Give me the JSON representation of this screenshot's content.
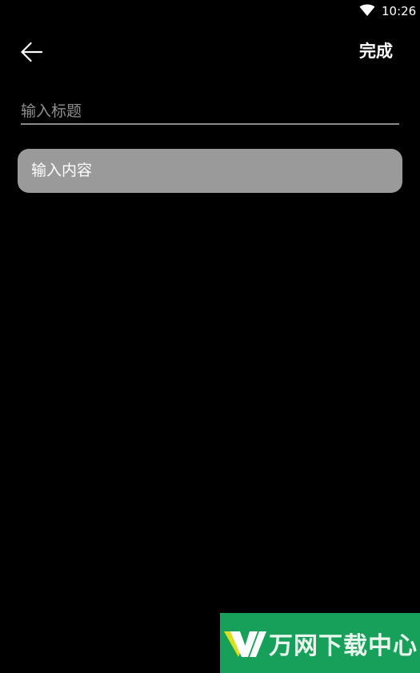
{
  "status_bar": {
    "time": "10:26",
    "wifi_icon": "wifi-icon"
  },
  "toolbar": {
    "back_icon": "arrow-left-icon",
    "done_label": "完成"
  },
  "editor": {
    "title_placeholder": "输入标题",
    "content_placeholder": "输入内容"
  },
  "watermark": {
    "text": "万网下载中心",
    "logo_letter": "W"
  },
  "colors": {
    "background": "#000000",
    "content_field": "#9a9a9a",
    "underline": "#8a8a8a",
    "watermark_bg": "#16a05a"
  }
}
